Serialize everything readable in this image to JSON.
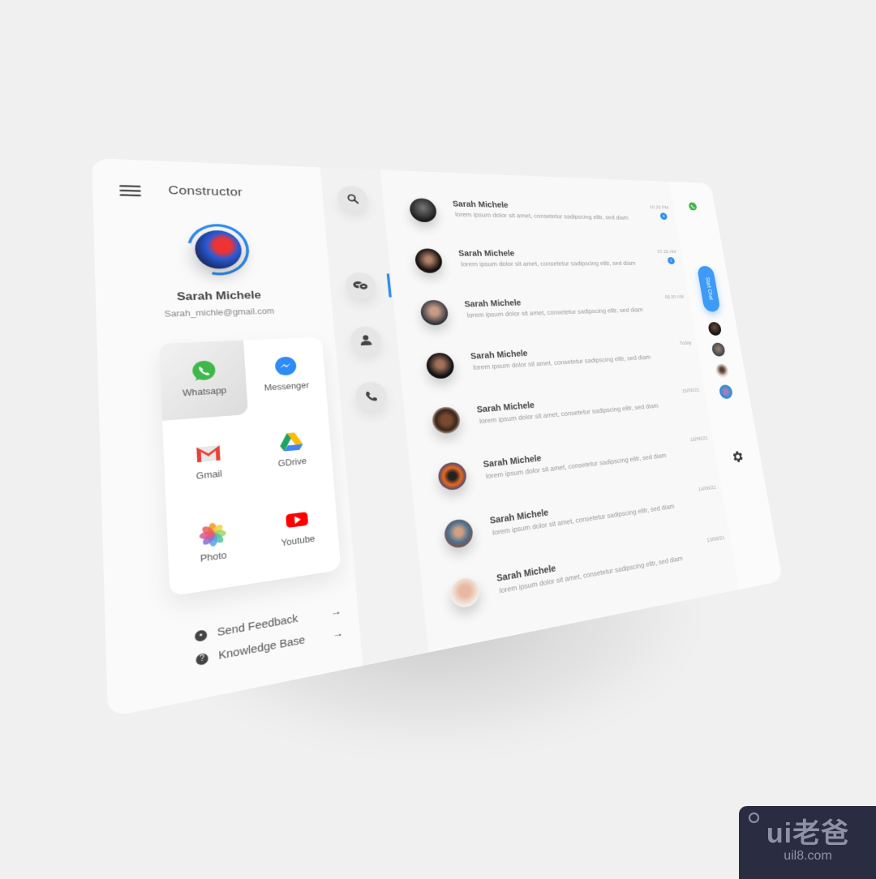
{
  "app": {
    "title": "Constructor",
    "accent_color": "#2f8cf0"
  },
  "profile": {
    "name": "Sarah Michele",
    "email": "Sarah_michle@gmail.com"
  },
  "apps": [
    {
      "label": "Whatsapp",
      "icon": "whatsapp-icon",
      "active": true
    },
    {
      "label": "Messenger",
      "icon": "messenger-icon",
      "active": false
    },
    {
      "label": "Gmail",
      "icon": "gmail-icon",
      "active": false
    },
    {
      "label": "GDrive",
      "icon": "gdrive-icon",
      "active": false
    },
    {
      "label": "Photo",
      "icon": "photos-icon",
      "active": false
    },
    {
      "label": "Youtube",
      "icon": "youtube-icon",
      "active": false
    }
  ],
  "footer_links": [
    {
      "label": "Send Feedback",
      "icon": "feedback-icon",
      "arrow": "→"
    },
    {
      "label": "Knowledge Base",
      "icon": "help-icon",
      "arrow": "→"
    }
  ],
  "rail": [
    {
      "name": "search",
      "icon": "search-icon"
    },
    {
      "name": "chats",
      "icon": "chat-bubbles-icon",
      "active": true
    },
    {
      "name": "contacts",
      "icon": "person-icon"
    },
    {
      "name": "calls",
      "icon": "phone-icon"
    }
  ],
  "chats": [
    {
      "name": "Sarah Michele",
      "message": "lorem ipsum dolor sit amet, consetetur sadipscing elitr, sed diam",
      "time": "10.25 PM",
      "badge": "8"
    },
    {
      "name": "Sarah Michele",
      "message": "lorem ipsum dolor sit amet, consetetur sadipscing elitr, sed diam",
      "time": "07.25 AM",
      "badge": "2"
    },
    {
      "name": "Sarah Michele",
      "message": "lorem ipsum dolor sit amet, consetetur sadipscing elitr, sed diam",
      "time": "06.00 AM",
      "badge": null
    },
    {
      "name": "Sarah Michele",
      "message": "lorem ipsum dolor sit amet, consetetur sadipscing elitr, sed diam",
      "time": "Today",
      "badge": null
    },
    {
      "name": "Sarah Michele",
      "message": "lorem ipsum dolor sit amet, consetetur sadipscing elitr, sed diam",
      "time": "15/06/21",
      "badge": null
    },
    {
      "name": "Sarah Michele",
      "message": "lorem ipsum dolor sit amet, consetetur sadipscing elitr, sed diam",
      "time": "15/06/21",
      "badge": null
    },
    {
      "name": "Sarah Michele",
      "message": "lorem ipsum dolor sit amet, consetetur sadipscing elitr, sed diam",
      "time": "14/06/21",
      "badge": null
    },
    {
      "name": "Sarah Michele",
      "message": "lorem ipsum dolor sit amet, consetetur sadipscing elitr, sed diam",
      "time": "13/06/21",
      "badge": null
    }
  ],
  "right": {
    "start_chat_label": "Start Chat",
    "online_count": 4
  },
  "watermark": {
    "main": "ui老爸",
    "site": "uil8.com"
  }
}
